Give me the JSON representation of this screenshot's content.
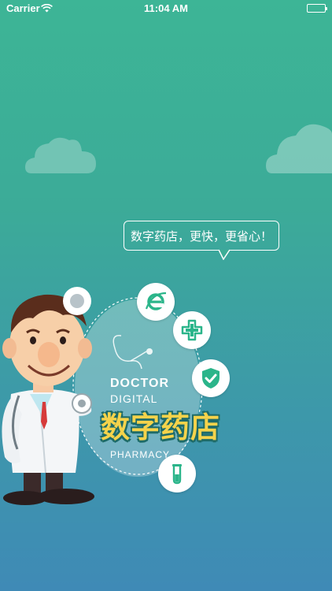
{
  "status_bar": {
    "carrier": "Carrier",
    "time": "11:04 AM"
  },
  "speech_bubble": {
    "text": "数字药店，更快，更省心！"
  },
  "logo": {
    "doctor": "DOCTOR",
    "digital": "DIGITAL",
    "title": "数字药店",
    "pharmacy": "PHARMACY"
  },
  "icons": [
    "browser-e-icon",
    "medical-cross-icon",
    "shield-check-icon",
    "test-tube-icon"
  ],
  "colors": {
    "bg_top": "#3db596",
    "bg_bottom": "#3f8ab6",
    "icon_green": "#2bb58a",
    "title_yellow": "#f5d34b",
    "title_outline": "#1e6b68"
  }
}
